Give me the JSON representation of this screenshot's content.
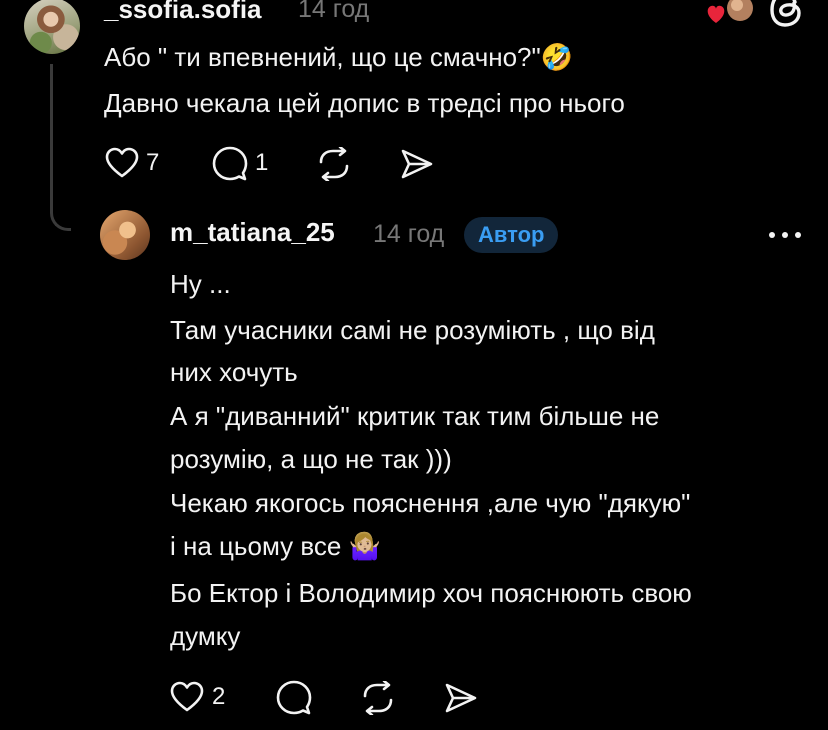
{
  "comment": {
    "username": "_ssofia.sofia",
    "time": "14 год",
    "lines": [
      "Або \" ти впевнений, що це смачно?\"🤣",
      "Давно чекала цей допис в тредсі про нього"
    ],
    "like_count": "7",
    "reply_count": "1"
  },
  "reply": {
    "username": "m_tatiana_25",
    "time": "14 год",
    "badge": "Автор",
    "lines": [
      "Ну ...",
      "Там учасники самі не розуміють , що від",
      "них хочуть",
      "А я \"диванний\" критик так тим більше не",
      "розумію, а що не так )))",
      "Чекаю якогось пояснення ,але чую \"дякую\"",
      "і на цьому  все 🤷🏼‍♀️",
      "Бо Ектор і Володимир хоч пояснюють свою",
      "думку"
    ],
    "like_count": "2"
  },
  "colors": {
    "background": "#000000",
    "text": "#f3f3f3",
    "muted": "#777777",
    "badge_bg": "#12263a",
    "badge_text": "#3a9df2",
    "heart": "#e8253b"
  },
  "icons": {
    "liked_avatar": "heart-avatar-icon",
    "app": "threads-logo-icon",
    "like": "heart-outline-icon",
    "reply": "comment-bubble-icon",
    "repost": "repost-icon",
    "share": "send-icon",
    "more": "more-dots-icon"
  }
}
